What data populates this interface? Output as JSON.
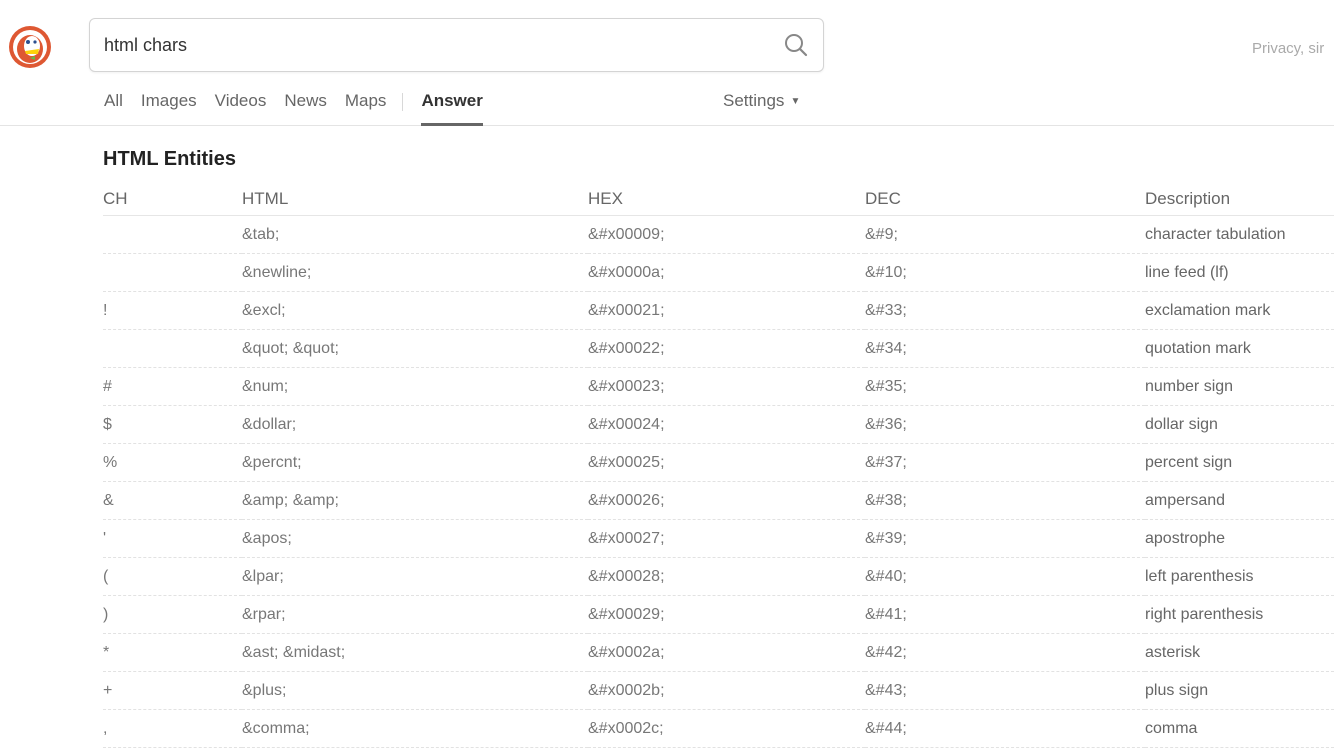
{
  "search": {
    "query": "html chars"
  },
  "header": {
    "privacy_text": "Privacy, sir"
  },
  "nav": {
    "tabs": [
      {
        "label": "All"
      },
      {
        "label": "Images"
      },
      {
        "label": "Videos"
      },
      {
        "label": "News"
      },
      {
        "label": "Maps"
      },
      {
        "label": "Answer",
        "active": true
      }
    ],
    "settings_label": "Settings"
  },
  "answer": {
    "title": "HTML Entities",
    "columns": {
      "ch": "CH",
      "html": "HTML",
      "hex": "HEX",
      "dec": "DEC",
      "description": "Description"
    },
    "rows": [
      {
        "ch": "",
        "html": "&tab;",
        "hex": "&#x00009;",
        "dec": "&#9;",
        "description": "character tabulation"
      },
      {
        "ch": "",
        "html": "&newline;",
        "hex": "&#x0000a;",
        "dec": "&#10;",
        "description": "line feed (lf)"
      },
      {
        "ch": "!",
        "html": "&excl;",
        "hex": "&#x00021;",
        "dec": "&#33;",
        "description": "exclamation mark"
      },
      {
        "ch": "",
        "html": "&quot; &quot;",
        "hex": "&#x00022;",
        "dec": "&#34;",
        "description": "quotation mark"
      },
      {
        "ch": "#",
        "html": "&num;",
        "hex": "&#x00023;",
        "dec": "&#35;",
        "description": "number sign"
      },
      {
        "ch": "$",
        "html": "&dollar;",
        "hex": "&#x00024;",
        "dec": "&#36;",
        "description": "dollar sign"
      },
      {
        "ch": "%",
        "html": "&percnt;",
        "hex": "&#x00025;",
        "dec": "&#37;",
        "description": "percent sign"
      },
      {
        "ch": "&",
        "html": "&amp; &amp;",
        "hex": "&#x00026;",
        "dec": "&#38;",
        "description": "ampersand"
      },
      {
        "ch": "'",
        "html": "&apos;",
        "hex": "&#x00027;",
        "dec": "&#39;",
        "description": "apostrophe"
      },
      {
        "ch": "(",
        "html": "&lpar;",
        "hex": "&#x00028;",
        "dec": "&#40;",
        "description": "left parenthesis"
      },
      {
        "ch": ")",
        "html": "&rpar;",
        "hex": "&#x00029;",
        "dec": "&#41;",
        "description": "right parenthesis"
      },
      {
        "ch": "*",
        "html": "&ast; &midast;",
        "hex": "&#x0002a;",
        "dec": "&#42;",
        "description": "asterisk"
      },
      {
        "ch": "+",
        "html": "&plus;",
        "hex": "&#x0002b;",
        "dec": "&#43;",
        "description": "plus sign"
      },
      {
        "ch": ",",
        "html": "&comma;",
        "hex": "&#x0002c;",
        "dec": "&#44;",
        "description": "comma"
      }
    ]
  },
  "icons": {
    "logo": "duckduckgo-logo-icon",
    "search": "search-icon",
    "settings_caret": "caret-down-icon"
  },
  "colors": {
    "logo_orange": "#de5833",
    "text_dark": "#333333",
    "text_muted": "#777777"
  }
}
